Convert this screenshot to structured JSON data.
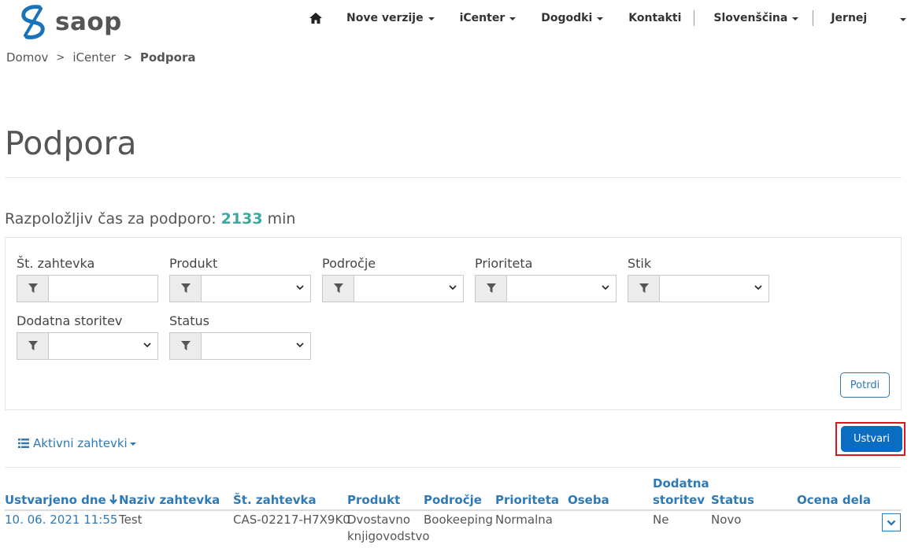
{
  "brand": {
    "name": "saop"
  },
  "nav": {
    "items": [
      {
        "label": "Nove verzije"
      },
      {
        "label": "iCenter"
      },
      {
        "label": "Dogodki"
      },
      {
        "label": "Kontakti"
      },
      {
        "label": "Slovenščina"
      },
      {
        "label": "Jernej"
      }
    ]
  },
  "breadcrumb": {
    "items": [
      "Domov",
      "iCenter"
    ],
    "current": "Podpora",
    "separator": ">"
  },
  "page": {
    "title": "Podpora",
    "available_label": "Razpoložljiv čas za podporo:",
    "available_value": "2133",
    "available_unit": "min"
  },
  "filters": {
    "fields": [
      {
        "label": "Št. zahtevka"
      },
      {
        "label": "Produkt"
      },
      {
        "label": "Področje"
      },
      {
        "label": "Prioriteta"
      },
      {
        "label": "Stik"
      },
      {
        "label": "Dodatna storitev"
      },
      {
        "label": "Status"
      }
    ],
    "confirm_label": "Potrdi"
  },
  "view": {
    "label": "Aktivni zahtevki"
  },
  "actions": {
    "create_label": "Ustvari"
  },
  "table": {
    "headers": {
      "created": "Ustvarjeno dne",
      "name": "Naziv zahtevka",
      "number": "Št. zahtevka",
      "product": "Produkt",
      "area": "Področje",
      "priority": "Prioriteta",
      "person": "Oseba",
      "extra_line1": "Dodatna",
      "extra_line2": "storitev",
      "status": "Status",
      "rating": "Ocena dela"
    },
    "rows": [
      {
        "created": "10. 06. 2021 11:55",
        "name": "Test",
        "number": "CAS-02217-H7X9K0",
        "product_line1": "Dvostavno",
        "product_line2": "knjigovodstvo",
        "area": "Bookeeping",
        "priority": "Normalna",
        "person": "",
        "extra": "Ne",
        "status": "Novo",
        "rating": ""
      }
    ]
  },
  "colors": {
    "accent": "#2f79b5",
    "primary_button": "#0a6dc2",
    "highlight": "#3aa9a0",
    "annotation_frame": "#e0131f"
  }
}
